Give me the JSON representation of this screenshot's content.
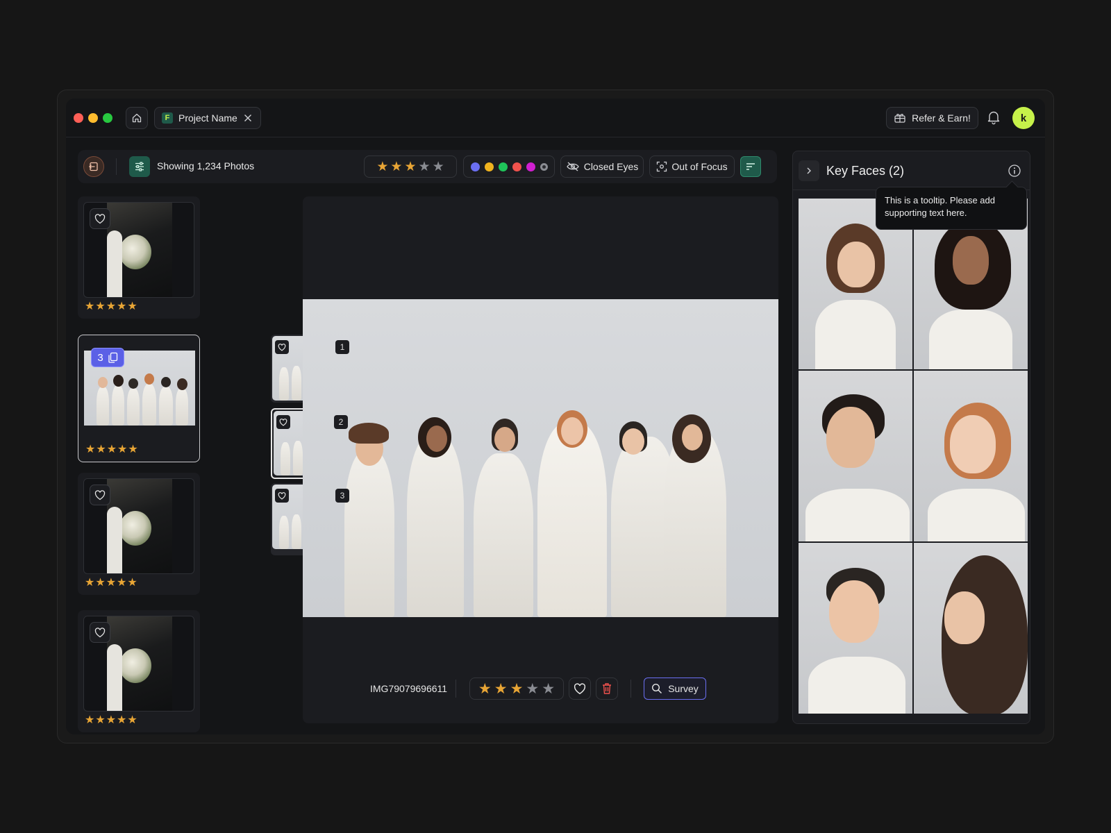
{
  "titlebar": {
    "tab_label": "Project Name",
    "refer_label": "Refer & Earn!",
    "avatar_initial": "k",
    "accent": "#c6f14a"
  },
  "toolbar": {
    "showing_text": "Showing 1,234 Photos",
    "rating_filter": 3,
    "color_labels": [
      "#6b6ff2",
      "#f0b31e",
      "#1fc45a",
      "#f0524d",
      "#d01fd0",
      "#8a8c92"
    ],
    "closed_eyes_label": "Closed Eyes",
    "out_of_focus_label": "Out of Focus"
  },
  "left_list": {
    "cards": [
      {
        "type": "single",
        "stars": 5
      },
      {
        "type": "stack",
        "stack_count": "3",
        "stars": 5
      },
      {
        "type": "single",
        "stars": 5
      },
      {
        "type": "single",
        "stars": 5
      }
    ],
    "stack_items": [
      "1",
      "2",
      "3"
    ],
    "selected_stack_item": "2"
  },
  "viewer": {
    "filename": "IMG79079696611",
    "rating": 3,
    "survey_label": "Survey"
  },
  "key_faces": {
    "title": "Key Faces (2)",
    "tooltip": "This is a tooltip. Please add supporting text here."
  }
}
